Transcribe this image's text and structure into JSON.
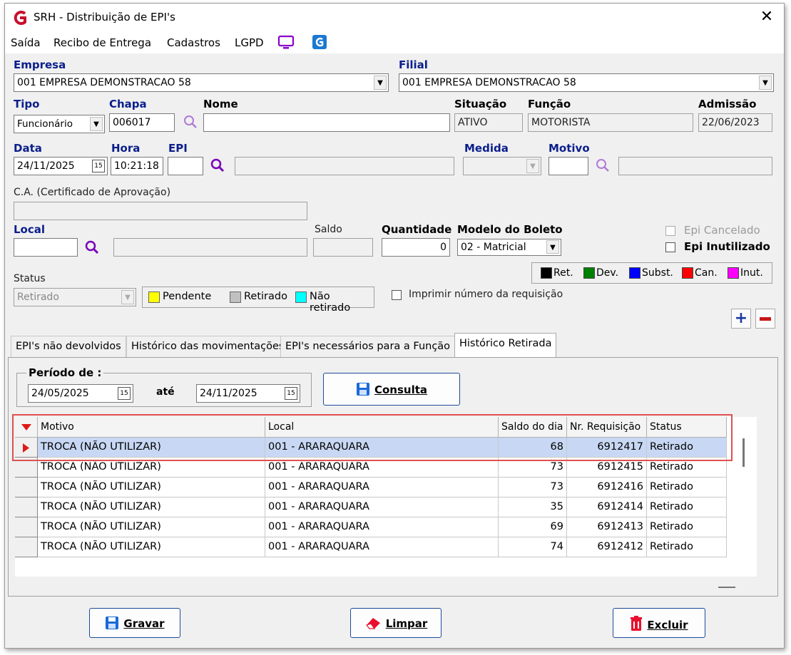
{
  "window": {
    "title": "SRH - Distribuição de EPI's"
  },
  "menu": {
    "saida": "Saída",
    "recibo": "Recibo de Entrega",
    "cadastros": "Cadastros",
    "lgpd": "LGPD"
  },
  "form": {
    "empresa_label": "Empresa",
    "empresa_value": "001 EMPRESA DEMONSTRACAO 58",
    "filial_label": "Filial",
    "filial_value": "001 EMPRESA DEMONSTRACAO 58",
    "tipo_label": "Tipo",
    "tipo_value": "Funcionário",
    "chapa_label": "Chapa",
    "chapa_value": "006017",
    "nome_label": "Nome",
    "nome_value": "",
    "situacao_label": "Situação",
    "situacao_value": "ATIVO",
    "funcao_label": "Função",
    "funcao_value": "MOTORISTA",
    "admissao_label": "Admissão",
    "admissao_value": "22/06/2023",
    "data_label": "Data",
    "data_value": "24/11/2025",
    "hora_label": "Hora",
    "hora_value": "10:21:18",
    "epi_label": "EPI",
    "epi_value": "",
    "medida_label": "Medida",
    "medida_value": "",
    "motivo_label": "Motivo",
    "motivo_value": "",
    "ca_label": "C.A. (Certificado de Aprovação)",
    "ca_value": "",
    "local_label": "Local",
    "local_value": "",
    "saldo_label": "Saldo",
    "saldo_value": "",
    "quantidade_label": "Quantidade",
    "quantidade_value": "0",
    "modelo_label": "Modelo do Boleto",
    "modelo_value": "02 - Matricial",
    "epi_cancelado": "Epi Cancelado",
    "epi_inutilizado": "Epi Inutilizado",
    "status_label": "Status",
    "status_value": "Retirado",
    "imprimir": "Imprimir número da requisição"
  },
  "status_legend": [
    {
      "label": "Pendente",
      "color": "#ffff00"
    },
    {
      "label": "Retirado",
      "color": "#c0c0c0"
    },
    {
      "label": "Não retirado",
      "color": "#00ffff"
    }
  ],
  "color_legend": [
    {
      "label": "Ret.",
      "color": "#000000"
    },
    {
      "label": "Dev.",
      "color": "#008000"
    },
    {
      "label": "Subst.",
      "color": "#0000ff"
    },
    {
      "label": "Can.",
      "color": "#ff0000"
    },
    {
      "label": "Inut.",
      "color": "#ff00ff"
    }
  ],
  "tabs": [
    {
      "label": "EPI's não devolvidos"
    },
    {
      "label": "Histórico das movimentações"
    },
    {
      "label": "EPI's necessários para a Função"
    },
    {
      "label": "Histórico Retirada"
    }
  ],
  "period": {
    "label": "Período de :",
    "from": "24/05/2025",
    "ate": "até",
    "to": "24/11/2025",
    "consulta": "Consulta"
  },
  "table": {
    "columns": [
      "Motivo",
      "Local",
      "Saldo do dia",
      "Nr. Requisição",
      "Status"
    ],
    "rows": [
      [
        "TROCA (NÃO UTILIZAR)",
        "001 - ARARAQUARA",
        "68",
        "6912417",
        "Retirado"
      ],
      [
        "TROCA (NÃO UTILIZAR)",
        "001 - ARARAQUARA",
        "73",
        "6912415",
        "Retirado"
      ],
      [
        "TROCA (NÃO UTILIZAR)",
        "001 - ARARAQUARA",
        "73",
        "6912416",
        "Retirado"
      ],
      [
        "TROCA (NÃO UTILIZAR)",
        "001 - ARARAQUARA",
        "35",
        "6912414",
        "Retirado"
      ],
      [
        "TROCA (NÃO UTILIZAR)",
        "001 - ARARAQUARA",
        "69",
        "6912413",
        "Retirado"
      ],
      [
        "TROCA (NÃO UTILIZAR)",
        "001 - ARARAQUARA",
        "74",
        "6912412",
        "Retirado"
      ]
    ]
  },
  "buttons": {
    "gravar": "Gravar",
    "limpar": "Limpar",
    "excluir": "Excluir"
  },
  "colors": {
    "label_blue": "#0a1e8c",
    "selection": "#c8d8f4",
    "highlight_box": "#e05050"
  }
}
